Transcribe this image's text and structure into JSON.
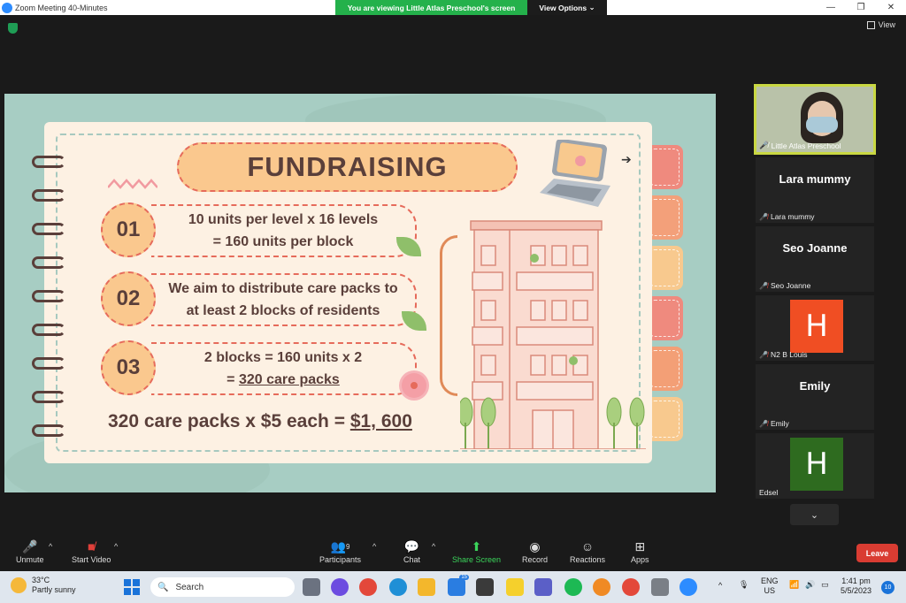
{
  "window": {
    "title": "Zoom Meeting 40-Minutes",
    "share_banner": "You are viewing Little Atlas Preschool's screen",
    "view_options": "View Options",
    "view_label": "View"
  },
  "slide": {
    "title": "FUNDRAISING",
    "items": [
      {
        "num": "01",
        "line1": "10 units per level x 16 levels",
        "line2": "= 160 units per block"
      },
      {
        "num": "02",
        "line1": "We aim to distribute care packs to",
        "line2": "at least 2 blocks of residents"
      },
      {
        "num": "03",
        "line1": "2 blocks = 160 units x 2",
        "line2_prefix": "= ",
        "line2_underlined": "320 care packs"
      }
    ],
    "total_prefix": "320 care packs x $5 each = ",
    "total_amount": "$1, 600"
  },
  "gallery": {
    "active_speaker": "Little Atlas Preschool",
    "participants": [
      {
        "display": "Lara mummy",
        "label": "Lara mummy"
      },
      {
        "display": "Seo Joanne",
        "label": "Seo Joanne"
      },
      {
        "avatar": "H",
        "label": "N2 B Louis",
        "color": "#f04e23"
      },
      {
        "display": "Emily",
        "label": "Emily"
      },
      {
        "avatar": "H",
        "label": "Edsel",
        "color": "#2e6b1f"
      }
    ]
  },
  "toolbar": {
    "unmute": "Unmute",
    "start_video": "Start Video",
    "participants": "Participants",
    "participants_count": "9",
    "chat": "Chat",
    "share_screen": "Share Screen",
    "record": "Record",
    "reactions": "Reactions",
    "apps": "Apps",
    "leave": "Leave"
  },
  "taskbar": {
    "temp": "33°C",
    "weather": "Partly sunny",
    "search": "Search",
    "lang1": "ENG",
    "lang2": "US",
    "time": "1:41 pm",
    "date": "5/5/2023",
    "notif_count": "10",
    "zoom_badge": "15"
  }
}
